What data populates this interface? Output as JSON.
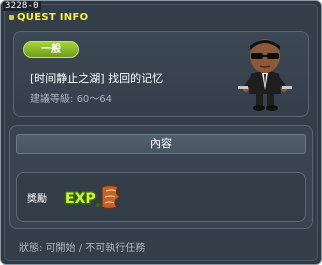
{
  "window": {
    "quest_id": "3228-0",
    "title": "QUEST INFO"
  },
  "summary": {
    "category": "一般",
    "quest_name": "[时间静止之湖] 找回的记忆",
    "level_label": "建議等級",
    "level_separator": ":",
    "level_range": "60～64",
    "npc_icon": "npc-sunglasses-agent-icon"
  },
  "content": {
    "header": "內容",
    "reward_label": "獎勵",
    "reward_icon": "exp-scroll-icon",
    "reward_icon_text": "EXP"
  },
  "status": {
    "label": "狀態",
    "separator": ":",
    "text": "可開始 / 不可執行任務"
  },
  "colors": {
    "title_yellow": "#f4f04a",
    "category_green": "#8ec12a",
    "panel_bg": "#3a4450",
    "window_bg": "#2f3944"
  }
}
